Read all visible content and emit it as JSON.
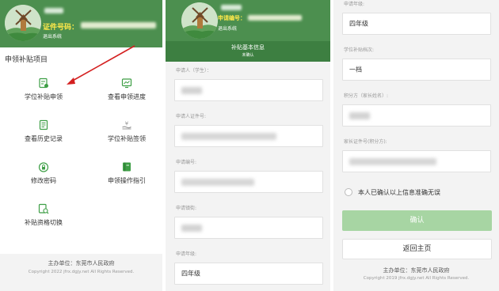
{
  "colors": {
    "header_green": "#4c8f4f",
    "accent_green": "#3d9e45",
    "label_yellow": "#ffe94a",
    "arrow_red": "#d42020",
    "confirm_disabled": "#a7d5a3"
  },
  "panel1": {
    "header": {
      "cert_label": "证件号码：",
      "logout": "退出系统"
    },
    "section_title": "申领补贴项目",
    "menu": [
      {
        "label": "学位补贴申领",
        "icon": "form-edit-icon"
      },
      {
        "label": "查看申领进度",
        "icon": "progress-screen-icon"
      },
      {
        "label": "查看历史记录",
        "icon": "history-doc-icon"
      },
      {
        "label": "学位补贴签领",
        "icon": "yuan-hand-icon"
      },
      {
        "label": "修改密码",
        "icon": "lock-icon"
      },
      {
        "label": "申领操作指引",
        "icon": "guide-book-icon"
      },
      {
        "label": "补贴资格切换",
        "icon": "switch-search-icon"
      }
    ],
    "footer": {
      "org": "主办单位：东莞市人民政府",
      "copyright": "Copyright 2022 jfrx.dgjy.net All Rights Reserved."
    }
  },
  "panel2": {
    "header": {
      "app_label": "申请编号：",
      "logout": "退出系统"
    },
    "subheader": {
      "title": "补贴基本信息",
      "status": "未确认"
    },
    "fields": [
      {
        "label": "申请人（学生）：",
        "value": ""
      },
      {
        "label": "申请人证件号:",
        "value": ""
      },
      {
        "label": "申请编号:",
        "value": ""
      },
      {
        "label": "申请镇街:",
        "value": ""
      },
      {
        "label": "申请年级:",
        "value": "四年级"
      }
    ]
  },
  "panel3": {
    "fields": [
      {
        "label": "申请年级:",
        "value": "四年级"
      },
      {
        "label": "学位补贴档次:",
        "value": "一档"
      },
      {
        "label": "积分方（家长姓名）:",
        "value": ""
      },
      {
        "label": "家长证件号(积分方):",
        "value": ""
      }
    ],
    "agree_text": "本人已确认以上信息准确无误",
    "confirm_button": "确认",
    "home_button": "返回主页",
    "footer": {
      "org": "主办单位：东莞市人民政府",
      "copyright": "Copyright 2019 jfrx.dgjy.net All Rights Reserved."
    }
  }
}
